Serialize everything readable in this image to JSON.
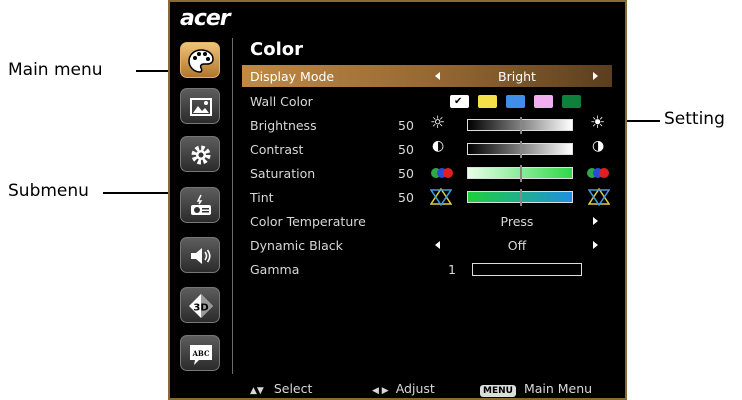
{
  "callouts": {
    "main_menu": "Main menu",
    "submenu": "Submenu",
    "setting": "Setting"
  },
  "osd": {
    "brand": "acer",
    "title": "Color",
    "nav_icons": [
      "palette-icon",
      "image-icon",
      "gear-icon",
      "projector-icon",
      "speaker-icon",
      "3d-icon",
      "language-icon"
    ],
    "rows": {
      "display_mode": {
        "label": "Display Mode",
        "value": "Bright"
      },
      "wall_color": {
        "label": "Wall Color",
        "swatches": [
          "#ffffff",
          "#f5e04a",
          "#3f8fe8",
          "#f0b0ef",
          "#0f7f3c"
        ]
      },
      "brightness": {
        "label": "Brightness",
        "value": "50"
      },
      "contrast": {
        "label": "Contrast",
        "value": "50"
      },
      "saturation": {
        "label": "Saturation",
        "value": "50"
      },
      "tint": {
        "label": "Tint",
        "value": "50"
      },
      "color_temperature": {
        "label": "Color Temperature",
        "value": "Press"
      },
      "dynamic_black": {
        "label": "Dynamic Black",
        "value": "Off"
      },
      "gamma": {
        "label": "Gamma",
        "value": "1"
      }
    },
    "footer": {
      "select": "Select",
      "adjust": "Adjust",
      "menu_key": "MENU",
      "main_menu": "Main Menu"
    }
  }
}
